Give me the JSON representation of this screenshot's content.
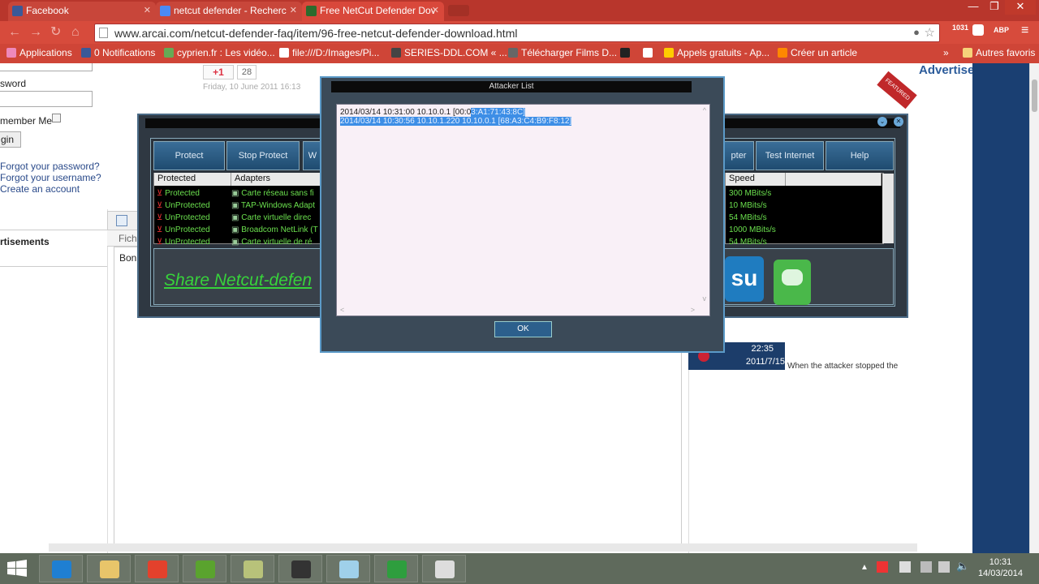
{
  "tabs": [
    {
      "label": "Facebook",
      "icon": "facebook-icon",
      "color": "#3b5998"
    },
    {
      "label": "netcut defender - Recherc",
      "icon": "google-icon",
      "color": "#4a8af4"
    },
    {
      "label": "Free NetCut Defender Dov",
      "icon": "site-icon",
      "color": "#2d6b2d"
    }
  ],
  "window_controls": {
    "minimize": "—",
    "maximize": "❐",
    "close": "✕"
  },
  "address_bar": {
    "url": "www.arcai.com/netcut-defender-faq/item/96-free-netcut-defender-download.html"
  },
  "extensions": {
    "badge1": "1031",
    "badge2": "ABP"
  },
  "bookmarks": [
    {
      "label": "Applications"
    },
    {
      "label": "0 Notifications"
    },
    {
      "label": "cyprien.fr : Les vidéo..."
    },
    {
      "label": "file:///D:/Images/Pi..."
    },
    {
      "label": "SERIES-DDL.COM « ..."
    },
    {
      "label": "Télécharger Films D..."
    },
    {
      "label": "Appels gratuits - Ap..."
    },
    {
      "label": "Créer un article"
    }
  ],
  "bookmarks_more": "»",
  "bookmarks_other": "Autres favoris",
  "page": {
    "password_label": "sword",
    "remember": "member Me",
    "login_button": "gin",
    "forgot_password": "Forgot your password?",
    "forgot_username": "Forgot your username?",
    "create_account": "Create an account",
    "advertisements_left": "rtisements",
    "gplus": "+1",
    "gplus_count": "28",
    "date": "Friday, 10 June 2011 16:13",
    "fichier": "Fichi",
    "bon": "Bon",
    "advertisements_right": "Advertisements",
    "featured": "FEATURED",
    "attacker_caption": "When the attacker stopped the",
    "thumb_time": "22:35",
    "thumb_date": "2011/7/15"
  },
  "netcut": {
    "buttons": [
      "Protect",
      "Stop Protect",
      "W",
      "pter",
      "Test Internet",
      "Help"
    ],
    "headers": {
      "protected": "Protected",
      "adapters": "Adapters",
      "speed": "Speed"
    },
    "rows": [
      {
        "status": "Protected",
        "adapter": "Carte réseau sans fi",
        "speed": "300 MBits/s"
      },
      {
        "status": "UnProtected",
        "adapter": "TAP-Windows Adapt",
        "speed": "10 MBits/s"
      },
      {
        "status": "UnProtected",
        "adapter": "Carte virtuelle direc",
        "speed": "54 MBits/s"
      },
      {
        "status": "UnProtected",
        "adapter": "Broadcom NetLink (T",
        "speed": "1000 MBits/s"
      },
      {
        "status": "UnProtected",
        "adapter": "Carte virtuelle de ré",
        "speed": "54 MBits/s"
      }
    ],
    "share_text": "Share Netcut-defen"
  },
  "dialog": {
    "title": "Attacker List",
    "lines": [
      {
        "text": "2014/03/14 10:31:00 10.10.0.1 [00:0",
        "sel": "3:A1:71:43:8C]"
      },
      {
        "text": "",
        "sel": "2014/03/14 10:30:56 10.10.1.220 10.10.0.1 [68:A3:C4:B9:F8:12]"
      }
    ],
    "ok": "OK"
  },
  "taskbar": {
    "apps": [
      {
        "name": "internet-explorer",
        "color": "#1f7fd2"
      },
      {
        "name": "file-explorer",
        "color": "#e8c56a"
      },
      {
        "name": "chrome",
        "color": "#e3412c"
      },
      {
        "name": "utorrent",
        "color": "#5aa32e"
      },
      {
        "name": "notepad",
        "color": "#b8c27a"
      },
      {
        "name": "camtasia",
        "color": "#333333"
      },
      {
        "name": "pen-tool",
        "color": "#9fd0ea"
      },
      {
        "name": "stats",
        "color": "#2e9e3e"
      },
      {
        "name": "snipping-tool",
        "color": "#dddddd"
      }
    ],
    "time": "10:31",
    "date": "14/03/2014"
  }
}
